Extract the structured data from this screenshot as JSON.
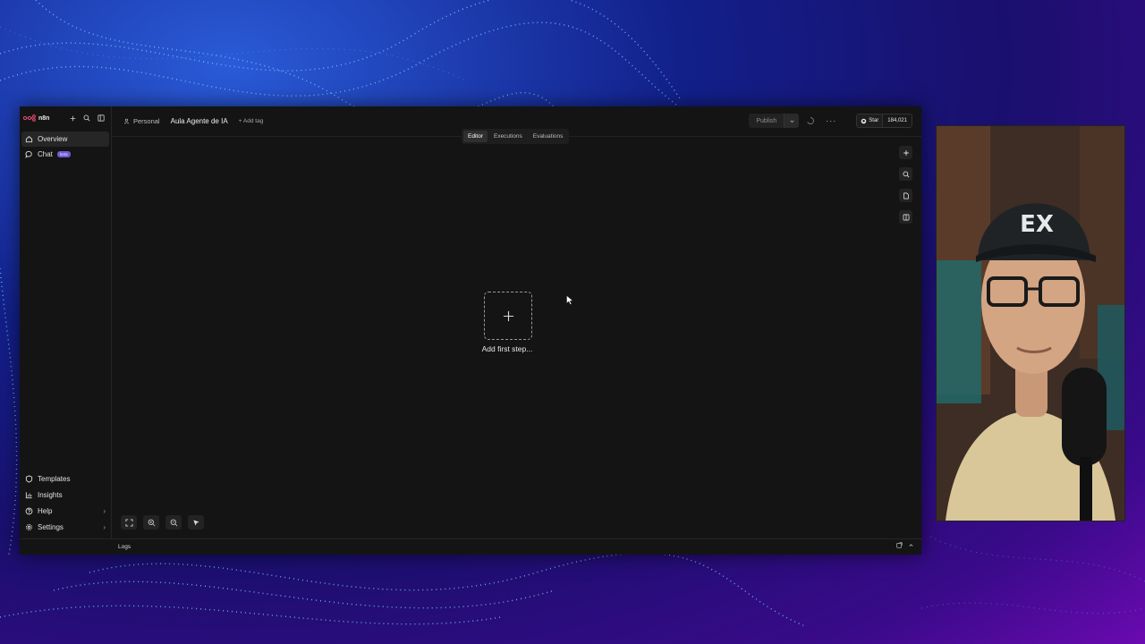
{
  "app": {
    "logo_text": "n8n"
  },
  "sidebar": {
    "items": [
      {
        "label": "Overview",
        "icon": "home-icon"
      },
      {
        "label": "Chat",
        "icon": "chat-icon",
        "badge": "beta"
      }
    ],
    "bottom_items": [
      {
        "label": "Templates",
        "icon": "templates-icon"
      },
      {
        "label": "Insights",
        "icon": "insights-icon"
      },
      {
        "label": "Help",
        "icon": "help-icon"
      },
      {
        "label": "Settings",
        "icon": "gear-icon"
      }
    ]
  },
  "header": {
    "project": "Personal",
    "workflow_title": "Aula Agente de IA",
    "add_tag": "+ Add tag",
    "publish_label": "Publish",
    "star_label": "Star",
    "star_count": "184,021"
  },
  "tabs": [
    {
      "label": "Editor",
      "active": true
    },
    {
      "label": "Executions",
      "active": false
    },
    {
      "label": "Evaluations",
      "active": false
    }
  ],
  "canvas": {
    "add_first_step": "Add first step..."
  },
  "footer": {
    "logs_label": "Logs"
  }
}
